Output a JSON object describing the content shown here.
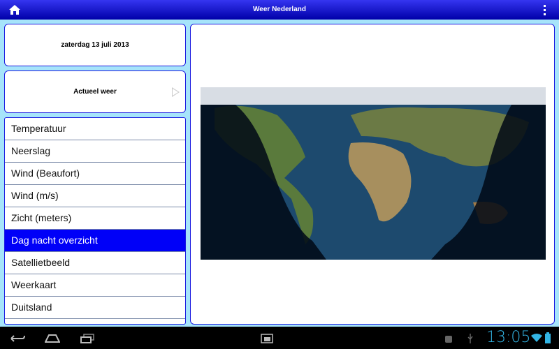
{
  "header": {
    "title": "Weer Nederland",
    "home_icon": "home-icon",
    "menu_icon": "overflow-menu-icon"
  },
  "date": "zaterdag 13 juli 2013",
  "current": {
    "label": "Actueel weer"
  },
  "menu": {
    "items": [
      "Temperatuur",
      "Neerslag",
      "Wind (Beaufort)",
      "Wind (m/s)",
      "Zicht (meters)",
      "Dag nacht overzicht",
      "Satellietbeeld",
      "Weerkaart",
      "Duitsland"
    ],
    "selected": "Dag nacht overzicht"
  },
  "statusbar": {
    "time": "13:05"
  },
  "colors": {
    "accent": "#0000f8",
    "background": "#a6e4fa",
    "clock": "#33b5e5"
  }
}
